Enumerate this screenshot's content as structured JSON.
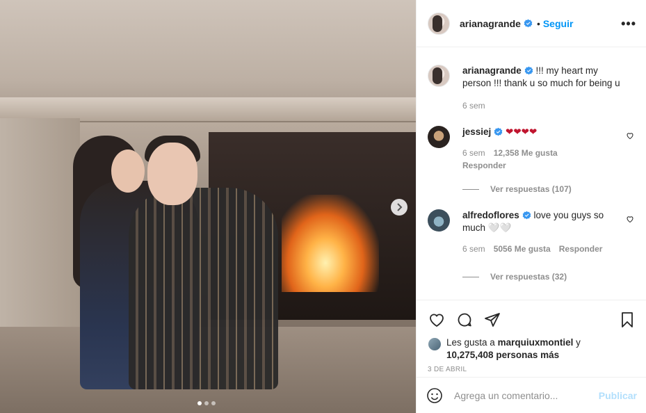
{
  "post": {
    "author": "arianagrande",
    "follow_label": "Seguir",
    "more_label": "•••",
    "caption_user": "arianagrande",
    "caption_text": " !!! my heart my person !!! thank u so much for being u",
    "caption_time": "6 sem",
    "carousel": {
      "slides": 3,
      "active_index": 0
    }
  },
  "comments": [
    {
      "user": "jessiej",
      "verified": true,
      "text": " ❤❤❤❤",
      "time": "6 sem",
      "likes": "12,358 Me gusta",
      "reply": "Responder",
      "view_replies": "Ver respuestas (107)"
    },
    {
      "user": "alfredoflores",
      "verified": true,
      "text": " love you guys so much 🤍🤍",
      "time": "6 sem",
      "likes": "5056 Me gusta",
      "reply": "Responder",
      "view_replies": "Ver respuestas (32)"
    }
  ],
  "likes": {
    "prefix": "Les gusta a ",
    "user": "marquiuxmontiel",
    "connector": " y",
    "others": "10,275,408 personas más"
  },
  "date": "3 DE ABRIL",
  "add_comment": {
    "placeholder": "Agrega un comentario...",
    "publish": "Publicar"
  },
  "colors": {
    "link": "#0095f6",
    "verified": "#3897f0",
    "publish_disabled": "#b2dffc",
    "heart": "#ed4956"
  }
}
